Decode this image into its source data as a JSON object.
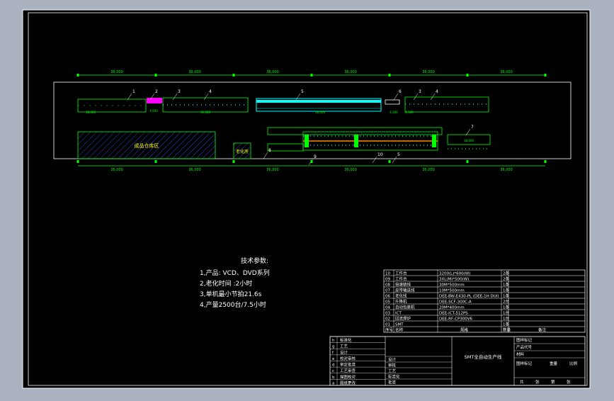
{
  "colors": {
    "viewport": "#a9b2be",
    "sheet": "#000000",
    "line": "#ffffff",
    "dim": "#00ff00",
    "conveyor": "#00ffff",
    "storage": "#1a2f9a",
    "label": "#ffff00"
  },
  "layout": {
    "dims_top": [
      "36,000",
      "36,000",
      "36,000",
      "36,000",
      "36,000",
      "36,000"
    ],
    "dims_bottom": [
      "36,000",
      "36,000",
      "36,000",
      "36,000",
      "36,000",
      "36,000"
    ],
    "callouts": [
      "1",
      "2",
      "3",
      "4",
      "5",
      "6",
      "3",
      "4",
      "7",
      "8",
      "9",
      "10",
      "5"
    ],
    "storage_label": "成品仓库区",
    "aging_label": "老化房",
    "sub_dims": [
      "18,000",
      "4,500",
      "30,000",
      "36,000",
      "4,500",
      "4,500",
      "18,000"
    ]
  },
  "tech": {
    "title": "技术参数:",
    "lines": [
      "1,产品: VCD、DVD系列",
      "2,老化时间 :2小时",
      "3,单机最小节拍21.6s",
      "4,产量2500台/7.5小时"
    ]
  },
  "parts": {
    "rows": [
      {
        "no": "10",
        "name": "工作台",
        "spec": "3200(L)*600(W)",
        "qty": "2条"
      },
      {
        "no": "09",
        "name": "工作台",
        "spec": "3XL(M)*500(W)",
        "qty": "2条"
      },
      {
        "no": "08",
        "name": "倍速链线",
        "spec": "30M*500mm",
        "qty": "1条"
      },
      {
        "no": "07",
        "name": "皮带输送线",
        "spec": "10M*500mm",
        "qty": "1条"
      },
      {
        "no": "06",
        "name": "老化线",
        "spec": "DEE-BW-E430-PL (DEE-1H DUI)",
        "qty": "1条"
      },
      {
        "no": "05",
        "name": "升降机",
        "spec": "DEE-SCF-300C-A",
        "qty": "2台"
      },
      {
        "no": "04",
        "name": "自动包装机",
        "spec": "20M*400mm",
        "qty": "1条"
      },
      {
        "no": "03",
        "name": "ICT",
        "spec": "DEE-ICT-512PS",
        "qty": "1台"
      },
      {
        "no": "02",
        "name": "回流焊炉",
        "spec": "DEE-RF-CP300V6",
        "qty": "1台"
      },
      {
        "no": "01",
        "name": "SMT",
        "spec": "",
        "qty": "1条"
      }
    ],
    "header": {
      "no": "序号",
      "name": "名称",
      "spec": "规格",
      "qty": "数量",
      "note": "备注"
    }
  },
  "title_block": {
    "project": "SMT全自动生产线",
    "rev_rows": [
      {
        "letter": "h",
        "text": "标准化"
      },
      {
        "letter": "g",
        "text": "工艺"
      },
      {
        "letter": "f",
        "text": "设计"
      },
      {
        "letter": "e",
        "text": "校对审核"
      },
      {
        "letter": "d",
        "text": "审定批准"
      },
      {
        "letter": "c",
        "text": "工艺审查"
      },
      {
        "letter": "b",
        "text": "描图校对"
      },
      {
        "letter": "a",
        "text": "图纸更改"
      }
    ],
    "sign_rows": [
      "设计",
      "审核",
      "工艺",
      "标准化",
      "批准"
    ],
    "right_labels": [
      "图样标记",
      "产品代号",
      "材料",
      "图样标记",
      "重量",
      "比例",
      "共",
      "张",
      "第",
      "张"
    ]
  }
}
